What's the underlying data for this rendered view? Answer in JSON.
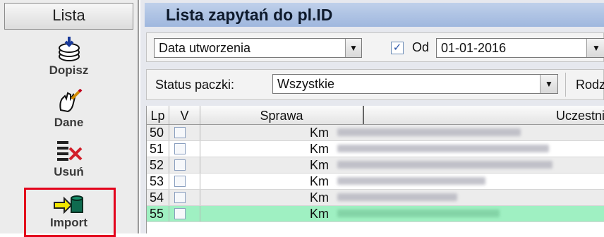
{
  "sidebar": {
    "header": "Lista",
    "items": [
      {
        "label": "Dopisz",
        "icon": "stack-add-icon"
      },
      {
        "label": "Dane",
        "icon": "hand-edit-icon"
      },
      {
        "label": "Usuń",
        "icon": "list-delete-icon"
      },
      {
        "label": "Import",
        "icon": "arrow-database-icon"
      }
    ]
  },
  "title": "Lista zapytań do pl.ID",
  "filters": {
    "date_field": "Data utworzenia",
    "od_checked": true,
    "od_label": "Od",
    "od_value": "01-01-2016",
    "status_label": "Status paczki:",
    "status_value": "Wszystkie",
    "rodz_label": "Rodz"
  },
  "grid": {
    "columns": [
      "Lp",
      "V",
      "Sprawa",
      "Uczestni"
    ],
    "rows": [
      {
        "lp": "50",
        "sprawa": "Km",
        "selected": false
      },
      {
        "lp": "51",
        "sprawa": "Km",
        "selected": false
      },
      {
        "lp": "52",
        "sprawa": "Km",
        "selected": false
      },
      {
        "lp": "53",
        "sprawa": "Km",
        "selected": false
      },
      {
        "lp": "54",
        "sprawa": "Km",
        "selected": false
      },
      {
        "lp": "55",
        "sprawa": "Km",
        "selected": true
      }
    ]
  },
  "colors": {
    "title_bar": "#a9bfe2",
    "selected_row": "#9ff0c2",
    "highlight_border": "#e3001b"
  }
}
